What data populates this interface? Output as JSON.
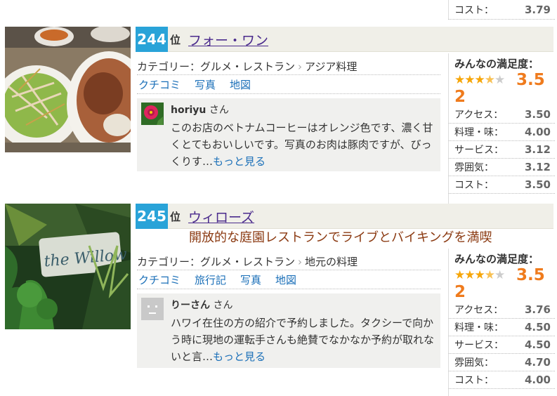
{
  "prev": {
    "cost_label": "コスト：",
    "cost_value": "3.79"
  },
  "entries": [
    {
      "rank": "244",
      "rank_suffix": "位",
      "name": "フォー・ワン",
      "catchcopy": "",
      "category": {
        "label": "カテゴリー：",
        "main": "グルメ・レストラン",
        "sub": "アジア料理"
      },
      "links": [
        "クチコミ",
        "写真",
        "地図"
      ],
      "review": {
        "user": "horiyu",
        "honorific": "さん",
        "text": "このお店のベトナムコーヒーはオレンジ色です、濃く甘くとてもおいしいです。写真のお肉は豚肉ですが、びっくりす…",
        "more": "もっと見る"
      },
      "satisfaction": {
        "label": "みんなの満足度：",
        "score_a": "3.5",
        "score_b": "2",
        "stars": 3.5
      },
      "scores": [
        {
          "label": "アクセス：",
          "value": "3.50"
        },
        {
          "label": "料理・味：",
          "value": "4.00"
        },
        {
          "label": "サービス：",
          "value": "3.12"
        },
        {
          "label": "雰囲気：",
          "value": "3.12"
        },
        {
          "label": "コスト：",
          "value": "3.50"
        }
      ]
    },
    {
      "rank": "245",
      "rank_suffix": "位",
      "name": "ウィローズ",
      "catchcopy": "開放的な庭園レストランでライブとバイキングを満喫",
      "category": {
        "label": "カテゴリー：",
        "main": "グルメ・レストラン",
        "sub": "地元の料理"
      },
      "links": [
        "クチコミ",
        "旅行記",
        "写真",
        "地図"
      ],
      "review": {
        "user": "りーさん",
        "honorific": "さん",
        "text": "ハワイ在住の方の紹介で予約しました。タクシーで向かう時に現地の運転手さんも絶賛でなかなか予約が取れないと言…",
        "more": "もっと見る"
      },
      "satisfaction": {
        "label": "みんなの満足度：",
        "score_a": "3.5",
        "score_b": "2",
        "stars": 3.5
      },
      "scores": [
        {
          "label": "アクセス：",
          "value": "3.76"
        },
        {
          "label": "料理・味：",
          "value": "4.50"
        },
        {
          "label": "サービス：",
          "value": "4.50"
        },
        {
          "label": "雰囲気：",
          "value": "4.70"
        },
        {
          "label": "コスト：",
          "value": "4.00"
        }
      ],
      "photo_text": "the Willow"
    }
  ],
  "colors": {
    "rank_bg": "#29a3d8",
    "score_orange": "#ef7b1d",
    "link_blue": "#1a6fb8",
    "name_purple": "#4a2a8c",
    "catch_brown": "#8b3a12"
  },
  "icons": {
    "star": "star-icon",
    "avatar1": "flower-avatar-icon",
    "avatar2": "default-avatar-icon",
    "breadcrumb_sep": "chevron-right-icon"
  }
}
